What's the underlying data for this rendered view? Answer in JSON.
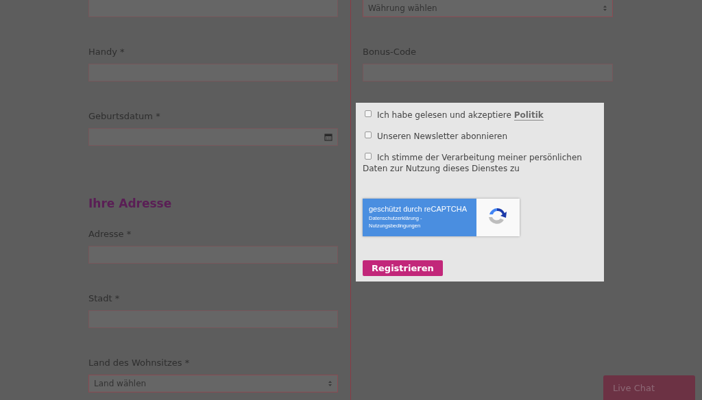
{
  "left_column": [
    {
      "kind": "input"
    },
    {
      "kind": "input",
      "label": "Handy *"
    },
    {
      "kind": "date",
      "label": "Geburtsdatum *"
    },
    {
      "kind": "heading",
      "label": "Ihre Adresse"
    },
    {
      "kind": "input",
      "label": "Adresse *"
    },
    {
      "kind": "input",
      "label": "Stadt *"
    },
    {
      "kind": "select",
      "label": "Land des Wohnsitzes *",
      "value": "Land wählen"
    }
  ],
  "right_column": [
    {
      "kind": "select",
      "value": "Währung wählen"
    },
    {
      "kind": "input",
      "label": "Bonus-Code"
    }
  ],
  "consents": [
    {
      "text": "Ich habe gelesen und akzeptiere **Politik**",
      "checked": false
    },
    {
      "text": "Unseren Newsletter abonnieren",
      "checked": false
    },
    {
      "text": "Ich stimme der Verarbeitung meiner persönlichen Daten zur Nutzung dieses Dienstes zu",
      "checked": false
    }
  ],
  "recaptcha": {
    "title": "geschützt durch reCAPTCHA",
    "links": "Datenschutzerklärung - Nutzungsbedingungen"
  },
  "submit": "Registrieren",
  "live_chat": "Live Chat"
}
